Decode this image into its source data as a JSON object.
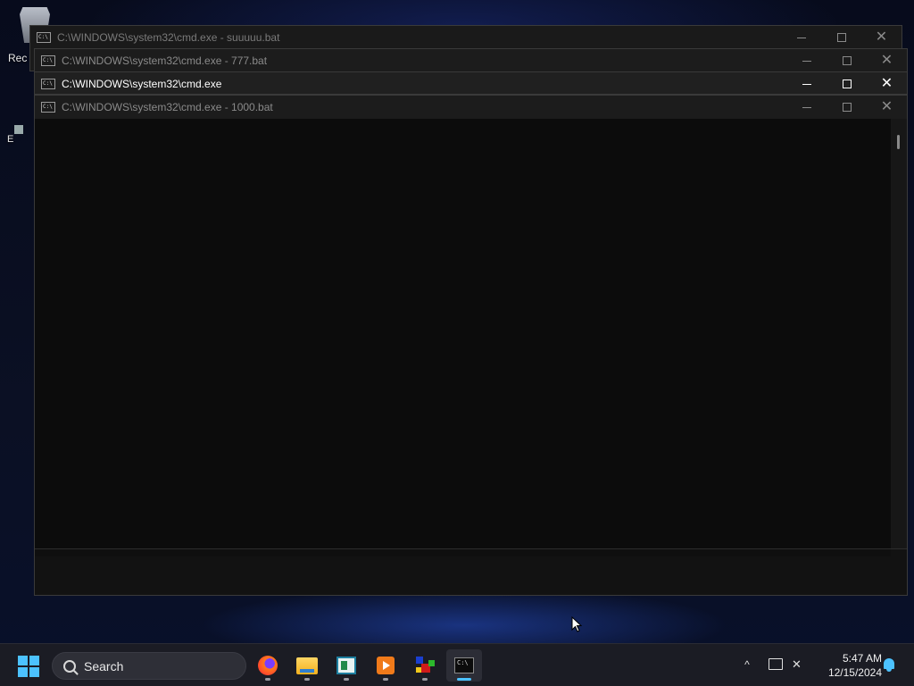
{
  "desktop": {
    "icons": [
      {
        "label": "Rec",
        "icon": "recycle-bin-icon"
      },
      {
        "label": "E",
        "icon": "app-shortcut-icon"
      }
    ]
  },
  "windows": [
    {
      "title": "C:\\WINDOWS\\system32\\cmd.exe - suuuuu.bat",
      "active": false
    },
    {
      "title": "C:\\WINDOWS\\system32\\cmd.exe - 777.bat",
      "active": false
    },
    {
      "title": "C:\\WINDOWS\\system32\\cmd.exe",
      "active": true
    },
    {
      "title": "C:\\WINDOWS\\system32\\cmd.exe - 1000.bat",
      "active": false
    }
  ],
  "window_controls": {
    "minimize": "minimize-icon",
    "maximize": "maximize-icon",
    "close": "close-icon"
  },
  "cmd_icon_text": "C:\\",
  "taskbar": {
    "search_label": "Search",
    "apps": [
      {
        "name": "Firefox",
        "icon": "firefox-icon",
        "running": true
      },
      {
        "name": "File Explorer",
        "icon": "folder-icon",
        "running": true
      },
      {
        "name": "Notes app",
        "icon": "notes-icon",
        "running": true
      },
      {
        "name": "Media player",
        "icon": "media-player-icon",
        "running": true
      },
      {
        "name": "Boxes app",
        "icon": "colored-boxes-icon",
        "running": true
      },
      {
        "name": "Command Prompt",
        "icon": "terminal-icon",
        "running": true,
        "active": true
      }
    ],
    "clock": {
      "time": "5:47 AM",
      "date": "12/15/2024"
    }
  },
  "colors": {
    "accent": "#4cc2ff",
    "console_bg": "#0c0c0c",
    "taskbar_bg": "#1b1c24"
  }
}
